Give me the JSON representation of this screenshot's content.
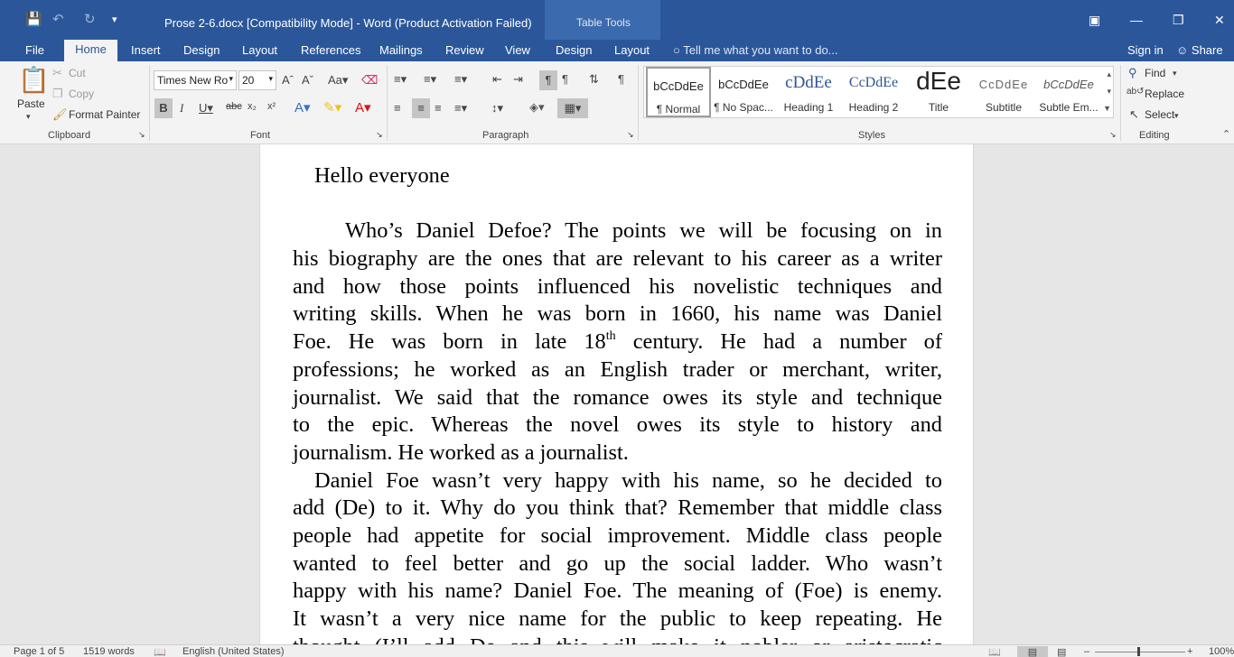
{
  "title_bar": {
    "document_title": "Prose 2-6.docx [Compatibility Mode] - Word (Product Activation Failed)",
    "contextual_tab_group": "Table Tools"
  },
  "tabs": [
    "File",
    "Home",
    "Insert",
    "Design",
    "Layout",
    "References",
    "Mailings",
    "Review",
    "View",
    "Design",
    "Layout"
  ],
  "tell_me_placeholder": "Tell me what you want to do...",
  "account": {
    "sign_in": "Sign in",
    "share": "Share"
  },
  "clipboard": {
    "paste": "Paste",
    "cut": "Cut",
    "copy": "Copy",
    "format_painter": "Format Painter",
    "label": "Clipboard"
  },
  "font": {
    "name": "Times New Ro",
    "size": "20",
    "label": "Font"
  },
  "paragraph": {
    "label": "Paragraph"
  },
  "styles": {
    "label": "Styles",
    "items": [
      {
        "preview": "bCcDdEe",
        "name": "¶ Normal"
      },
      {
        "preview": "bCcDdEe",
        "name": "¶ No Spac..."
      },
      {
        "preview": "cDdEe",
        "name": "Heading 1"
      },
      {
        "preview": "CcDdEe",
        "name": "Heading 2"
      },
      {
        "preview": "dEe",
        "name": "Title"
      },
      {
        "preview": "CcDdEe",
        "name": "Subtitle"
      },
      {
        "preview": "bCcDdEe",
        "name": "Subtle Em..."
      }
    ]
  },
  "editing": {
    "find": "Find",
    "replace": "Replace",
    "select": "Select",
    "label": "Editing"
  },
  "document": {
    "heading": "Hello everyone",
    "p1": [
      "Who’s Daniel Defoe? The points we will be focusing on in",
      "his biography are the ones that are relevant to his career as a writer",
      "and how those points influenced his novelistic techniques and",
      "writing skills. When he was born in 1660, his name was Daniel"
    ],
    "p1_line5_before": "Foe. He was born in late 18",
    "p1_line5_sup": "th",
    "p1_line5_after": " century. He had a number of",
    "p1_rest": [
      "professions; he worked as an English trader or merchant, writer,",
      "journalist. We said that the romance owes its style and technique",
      "to the epic. Whereas the novel owes its style to history and"
    ],
    "p1_last": "journalism. He worked as a journalist.",
    "p2": [
      "Daniel Foe wasn’t very happy with his name, so he decided to",
      "add (De) to it. Why do you think that? Remember that middle class",
      "people had appetite for social improvement. Middle class people",
      "wanted to feel better and go up the social ladder. Who wasn’t",
      "happy with his name? Daniel Foe. The meaning of (Foe) is enemy.",
      "It wasn’t a very nice name for the public to keep repeating. He",
      "thought (I’ll add De and this will make it nobler or aristocratic"
    ]
  },
  "status_bar": {
    "page": "Page 1 of 5",
    "words": "1519 words",
    "language": "English (United States)",
    "zoom": "100%"
  },
  "colors": {
    "titlebar": "#2b579a",
    "ribbon": "#f3f3f3"
  }
}
